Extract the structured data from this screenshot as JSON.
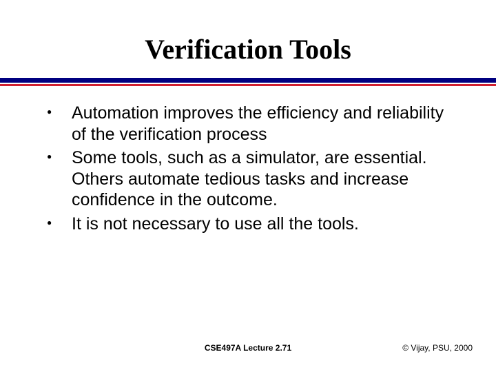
{
  "slide": {
    "title": "Verification Tools",
    "bullets": [
      "Automation improves the efficiency and reliability of the verification process",
      "Some tools, such as a simulator, are essential. Others automate tedious tasks and increase confidence in the outcome.",
      "It is not necessary to use all the tools."
    ],
    "footer": {
      "center": "CSE497A Lecture 2.71",
      "right": "© Vijay, PSU, 2000"
    }
  }
}
